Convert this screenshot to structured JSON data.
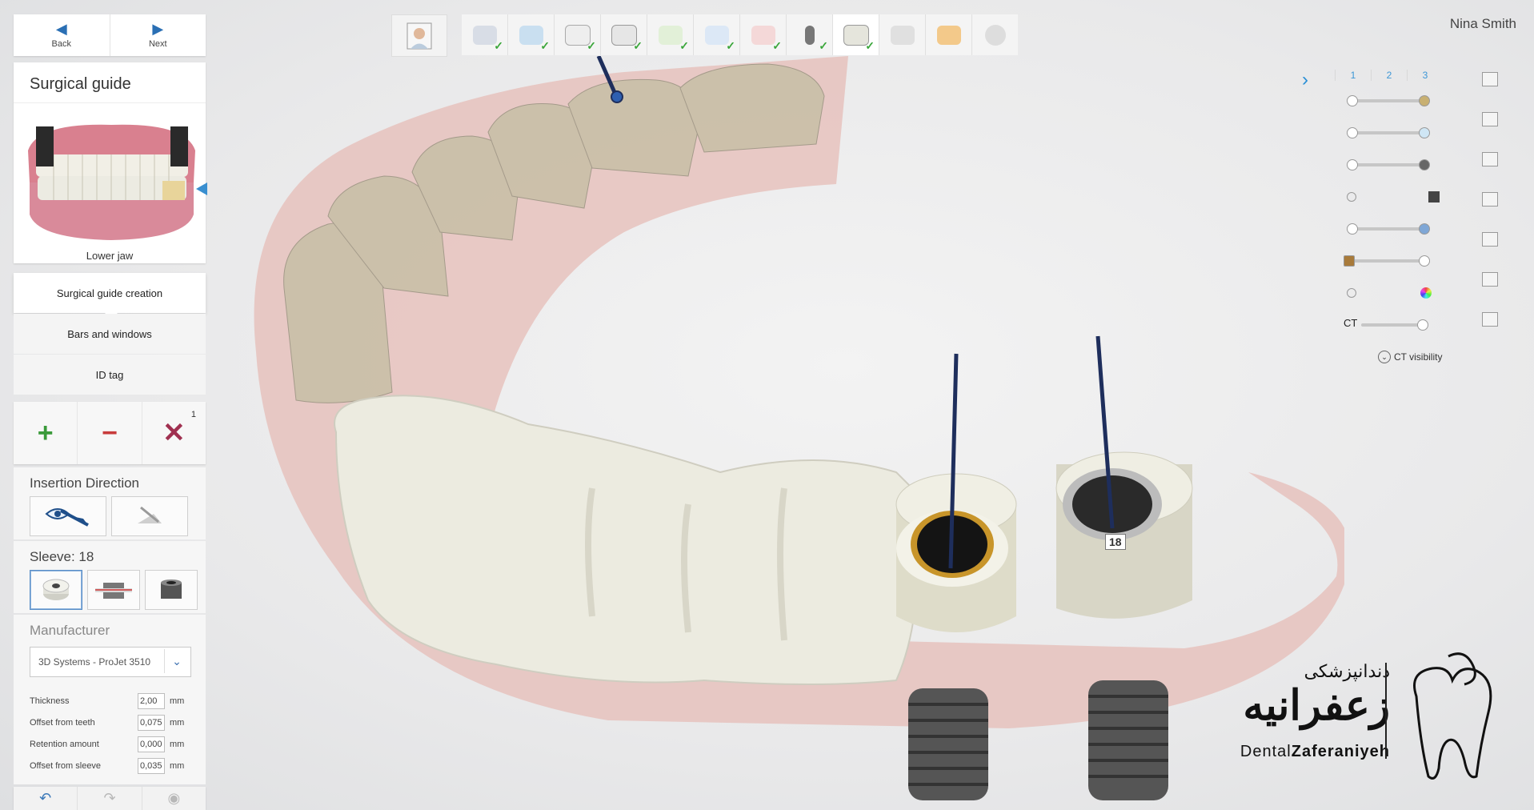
{
  "nav": {
    "back_label": "Back",
    "next_label": "Next"
  },
  "panel": {
    "title": "Surgical guide",
    "jaw_label": "Lower jaw",
    "steps": [
      {
        "label": "Surgical guide creation",
        "active": true
      },
      {
        "label": "Bars and windows",
        "active": false
      },
      {
        "label": "ID tag",
        "active": false
      }
    ],
    "tool_count": "1"
  },
  "insertion": {
    "title": "Insertion Direction"
  },
  "sleeve": {
    "title": "Sleeve: 18"
  },
  "manufacturer": {
    "title": "Manufacturer",
    "value": "3D Systems - ProJet 3510"
  },
  "params": [
    {
      "label": "Thickness",
      "value": "2,00",
      "unit": "mm"
    },
    {
      "label": "Offset from teeth",
      "value": "0,075",
      "unit": "mm"
    },
    {
      "label": "Retention amount",
      "value": "0,000",
      "unit": "mm"
    },
    {
      "label": "Offset from sleeve",
      "value": "0,035",
      "unit": "mm"
    }
  ],
  "user": {
    "name": "Nina Smith"
  },
  "right_panel": {
    "tabs": [
      "1",
      "2",
      "3"
    ],
    "ct_label": "CT",
    "ct_visibility": "CT visibility"
  },
  "scene": {
    "sleeve_tag": "18"
  },
  "logo": {
    "persian_small": "دندانپزشکی",
    "persian_large": "زعفرانیه",
    "english_prefix": "Dental",
    "english_bold": "Zaferaniyeh"
  },
  "colors": {
    "accent": "#2a8fd6",
    "check": "#3aa63a",
    "add": "#3a9a3a",
    "remove": "#c83c3c",
    "delete": "#a03050"
  }
}
